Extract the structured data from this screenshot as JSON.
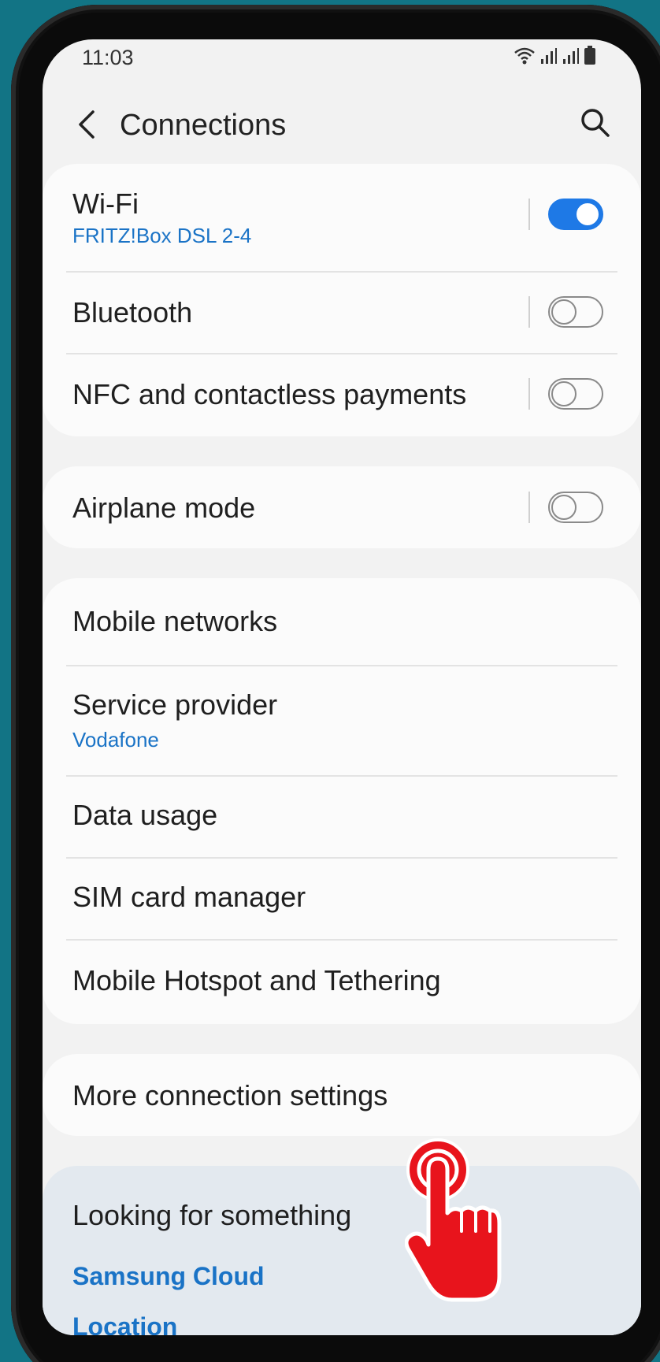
{
  "status_bar": {
    "time": "11:03"
  },
  "header": {
    "title": "Connections"
  },
  "group1": [
    {
      "title": "Wi-Fi",
      "subtitle": "FRITZ!Box DSL 2-4",
      "toggle": true
    },
    {
      "title": "Bluetooth",
      "toggle": false
    },
    {
      "title": "NFC and contactless payments",
      "toggle": false
    }
  ],
  "group2": [
    {
      "title": "Airplane mode",
      "toggle": false
    }
  ],
  "group3": [
    {
      "title": "Mobile networks"
    },
    {
      "title": "Service provider",
      "subtitle": "Vodafone"
    },
    {
      "title": "Data usage"
    },
    {
      "title": "SIM card manager"
    },
    {
      "title": "Mobile Hotspot and Tethering"
    }
  ],
  "group4": [
    {
      "title": "More connection settings"
    }
  ],
  "suggestions": {
    "title": "Looking for something",
    "links": [
      "Samsung Cloud",
      "Location"
    ]
  },
  "colors": {
    "accent": "#1e79e6",
    "link": "#1a73c6",
    "background": "#127485",
    "pointer": "#e8141c"
  },
  "icons": [
    "back-arrow-icon",
    "search-icon",
    "wifi-icon",
    "signal-icon",
    "battery-icon",
    "tap-hand-icon"
  ]
}
